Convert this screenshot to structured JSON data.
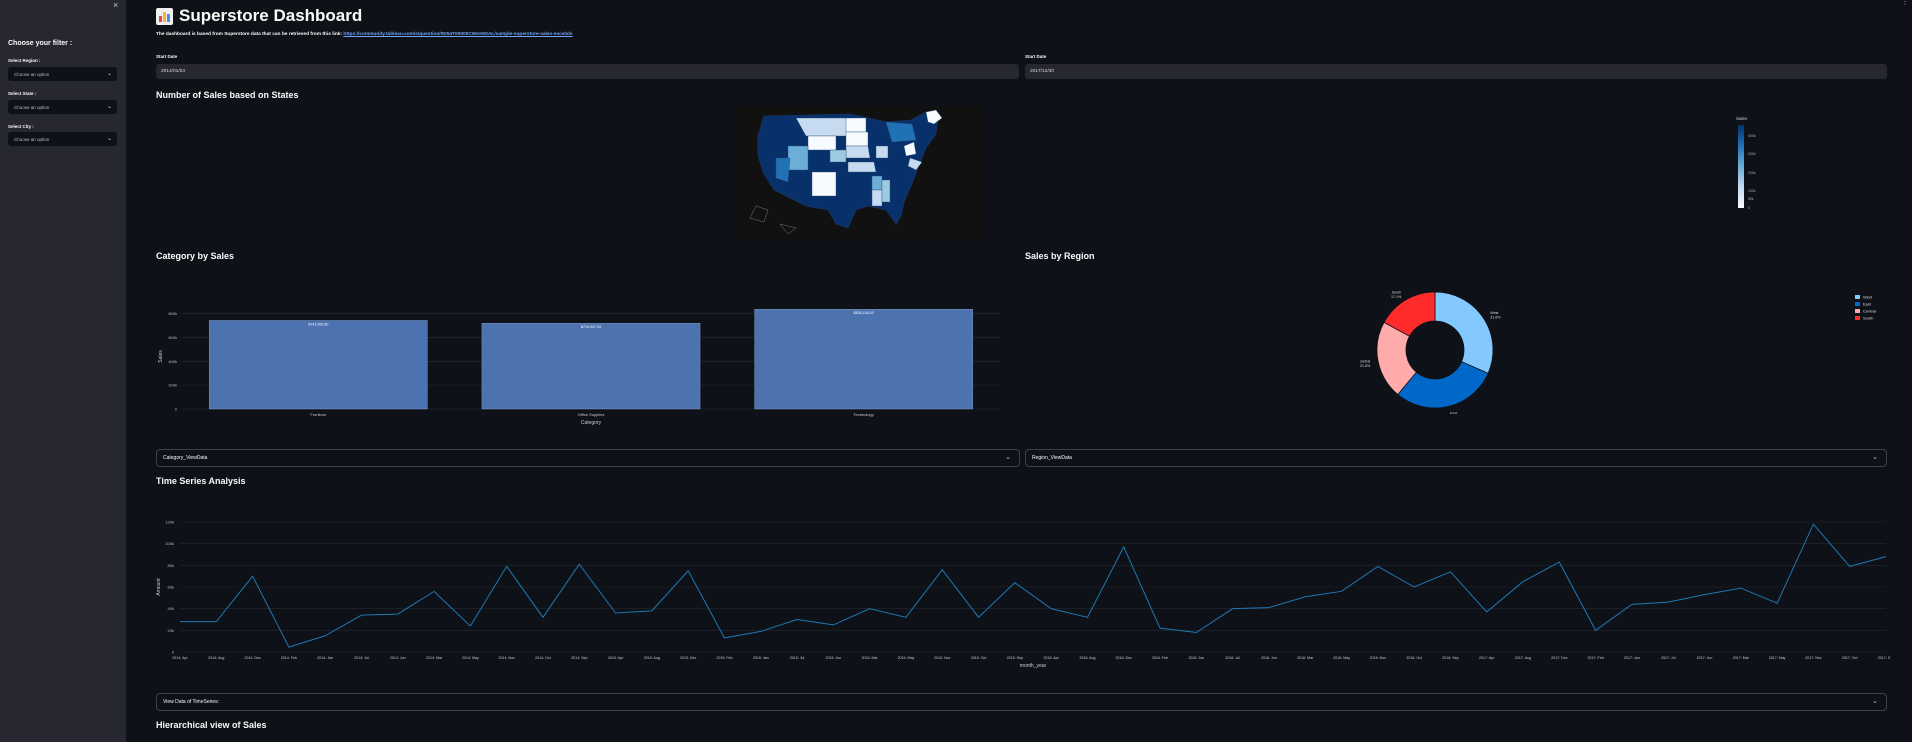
{
  "sidebar": {
    "close_icon": "×",
    "filter_title": "Choose your filter :",
    "filters": [
      {
        "label": "Select Region :",
        "value": "Choose an option"
      },
      {
        "label": "Select State :",
        "value": "Choose an option"
      },
      {
        "label": "Select City :",
        "value": "Choose an option"
      }
    ]
  },
  "header": {
    "title": "Superstore Dashboard",
    "icon": "bar-chart-icon",
    "intro_text": "The dashboard is based from Superstore data that can be retrieved from this link:",
    "intro_link": "https://community.tableau.com/s/question/0D54T00000CWeX8SAL/sample-superstore-sales-excelxls"
  },
  "dates": {
    "start_label": "Start Date",
    "start_value": "2014/01/03",
    "end_label": "Start Date",
    "end_value": "2017/12/30"
  },
  "map_section": {
    "title": "Number of Sales based on States",
    "colorbar_title": "Sales",
    "colorbar_ticks": [
      "400k",
      "300k",
      "200k",
      "100k",
      "50k",
      "0"
    ],
    "colorscale": [
      "#08306b",
      "#2171b5",
      "#6baed6",
      "#c6dbef",
      "#f7fbff"
    ]
  },
  "category_section": {
    "title": "Category by Sales",
    "expander_label": "Category_ViewData"
  },
  "region_section": {
    "title": "Sales by Region",
    "expander_label": "Region_ViewData"
  },
  "time_section": {
    "title": "Time Series Analysis",
    "expander_label": "View Data of TimeSeries:"
  },
  "hierarchy_section": {
    "title": "Hierarchical view of Sales"
  },
  "chart_data": [
    {
      "type": "bar",
      "title": "",
      "categories": [
        "Furniture",
        "Office Supplies",
        "Technology"
      ],
      "values": [
        741999.8,
        719047.03,
        836154.03
      ],
      "data_labels": [
        "$741,999.80",
        "$719,047.03",
        "$836,154.03"
      ],
      "xlabel": "Category",
      "ylabel": "Sales",
      "y_ticks": [
        "0",
        "200k",
        "400k",
        "600k",
        "800k"
      ],
      "ylim": [
        0,
        880000
      ],
      "color": "#4c72b0",
      "grid": true
    },
    {
      "type": "pie",
      "title": "",
      "hole": true,
      "slices": [
        {
          "name": "West",
          "percent": "31.6%",
          "value": 31.6,
          "color": "#83c9ff"
        },
        {
          "name": "East",
          "percent": "29.5%",
          "value": 29.5,
          "color": "#0068c9"
        },
        {
          "name": "Central",
          "percent": "21.8%",
          "value": 21.8,
          "color": "#ffabab"
        },
        {
          "name": "South",
          "percent": "17.1%",
          "value": 17.1,
          "color": "#ff2b2b"
        }
      ],
      "legend_position": "top-right"
    },
    {
      "type": "line",
      "title": "",
      "xlabel": "month_year",
      "ylabel": "Amount",
      "y_ticks": [
        "0",
        "20k",
        "40k",
        "60k",
        "80k",
        "100k",
        "120k"
      ],
      "ylim": [
        0,
        120000
      ],
      "x_ticks": [
        "2014: Apr",
        "2014: Aug",
        "2014: Dec",
        "2014: Feb",
        "2014: Jan",
        "2014: Jul",
        "2014: Jun",
        "2014: Mar",
        "2014: May",
        "2014: Nov",
        "2014: Oct",
        "2014: Sep",
        "2015: Apr",
        "2015: Aug",
        "2015: Dec",
        "2015: Feb",
        "2015: Jan",
        "2015: Jul",
        "2015: Jun",
        "2015: Mar",
        "2015: May",
        "2015: Nov",
        "2015: Oct",
        "2015: Sep",
        "2016: Apr",
        "2016: Aug",
        "2016: Dec",
        "2016: Feb",
        "2016: Jan",
        "2016: Jul",
        "2016: Jun",
        "2016: Mar",
        "2016: May",
        "2016: Nov",
        "2016: Oct",
        "2016: Sep",
        "2017: Apr",
        "2017: Aug",
        "2017: Dec",
        "2017: Feb",
        "2017: Jan",
        "2017: Jul",
        "2017: Jun",
        "2017: Mar",
        "2017: May",
        "2017: Nov",
        "2017: Oct",
        "2017: Sep"
      ],
      "series": [
        {
          "values": [
            28000,
            28000,
            70000,
            4500,
            15000,
            34000,
            35000,
            56000,
            24000,
            79000,
            32000,
            81000,
            36000,
            38000,
            75000,
            13000,
            19000,
            30000,
            25000,
            40000,
            32000,
            76000,
            32000,
            64000,
            40000,
            32000,
            97000,
            22000,
            18000,
            40000,
            41000,
            51000,
            56000,
            79000,
            60000,
            74000,
            37000,
            65000,
            83000,
            20000,
            44000,
            46000,
            53000,
            59000,
            45000,
            118000,
            79000,
            88000
          ]
        }
      ],
      "color": "#1f77b4",
      "grid": true
    }
  ]
}
